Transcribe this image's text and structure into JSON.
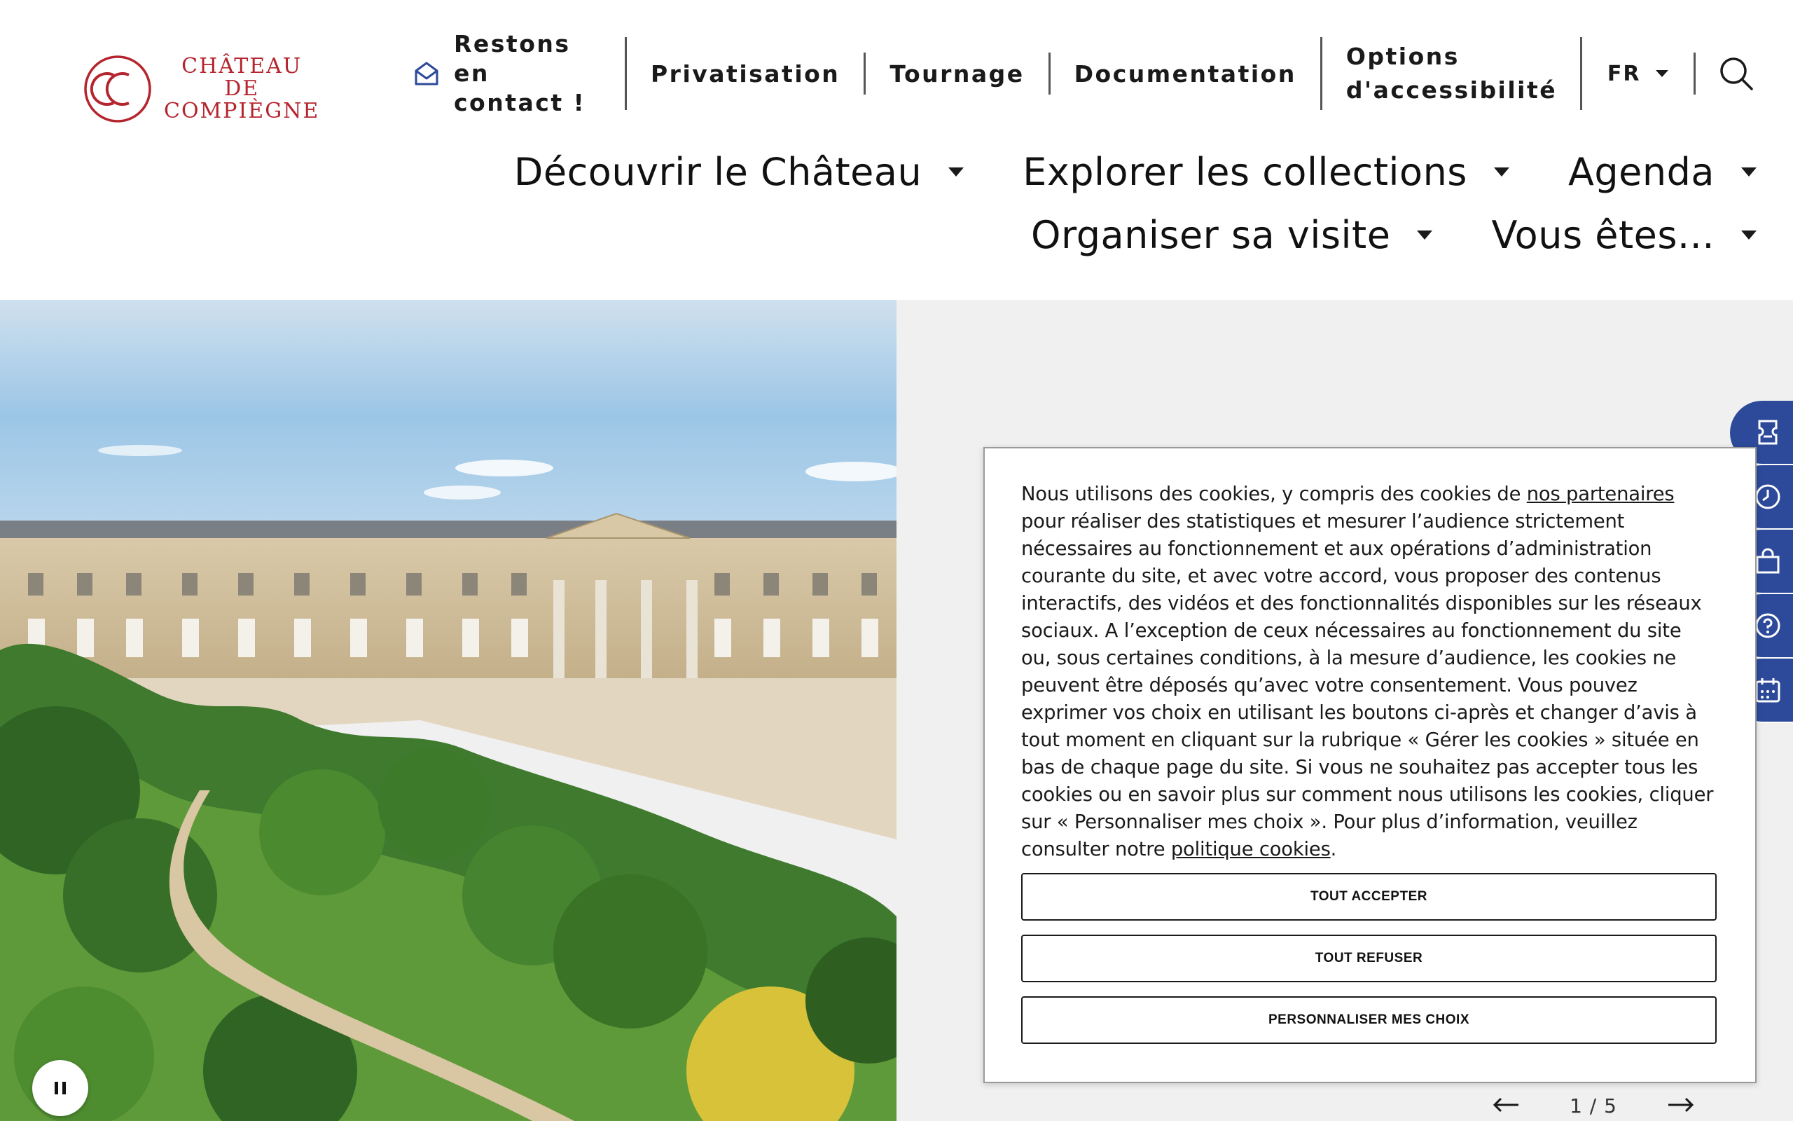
{
  "logo": {
    "line1": "CHÂTEAU",
    "line2": "DE",
    "line3": "COMPIÈGNE",
    "brand_color": "#b5252e"
  },
  "utility_nav": {
    "contact_line1": "Restons en",
    "contact_line2": "contact !",
    "contact_icon": "envelope-icon",
    "privatisation": "Privatisation",
    "tournage": "Tournage",
    "documentation": "Documentation",
    "accessibility_line1": "Options",
    "accessibility_line2": "d'accessibilité",
    "language": "FR",
    "search_icon": "search-icon"
  },
  "main_nav": {
    "row1": [
      "Découvrir le Château",
      "Explorer les collections",
      "Agenda"
    ],
    "row2": [
      "Organiser sa visite",
      "Vous êtes..."
    ]
  },
  "hero": {
    "slide_counter": "1 / 5",
    "prev_icon": "arrow-left-icon",
    "next_icon": "arrow-right-icon",
    "pause_icon": "pause-icon"
  },
  "side_tabs": [
    "ticket-icon",
    "clock-icon",
    "shopping-bag-icon",
    "help-icon",
    "calendar-icon"
  ],
  "side_tab_color": "#2d4a9a",
  "cookie_banner": {
    "text_before_link1": "Nous utilisons des cookies, y compris des cookies de ",
    "link1": "nos partenaires",
    "text_after_link1": " pour réaliser des statistiques et mesurer l’audience strictement nécessaires au fonctionnement et aux opérations d’administration courante du site, et avec votre accord, vous proposer des contenus interactifs, des vidéos et des fonctionnalités disponibles sur les réseaux sociaux. A l’exception de ceux nécessaires au fonctionnement du site ou, sous certaines conditions, à la mesure d’audience, les cookies ne peuvent être déposés qu’avec votre consentement. Vous pouvez exprimer vos choix en utilisant les boutons ci-après et changer d’avis à tout moment en cliquant sur la rubrique « Gérer les cookies » située en bas de chaque page du site. Si vous ne souhaitez pas accepter tous les cookies ou en savoir plus sur comment nous utilisons les cookies, cliquer sur « Personnaliser mes choix ». Pour plus d’information, veuillez consulter notre ",
    "link2": "politique cookies",
    "text_end": ".",
    "accept_all": "TOUT ACCEPTER",
    "refuse_all": "TOUT REFUSER",
    "customize": "PERSONNALISER MES CHOIX"
  }
}
